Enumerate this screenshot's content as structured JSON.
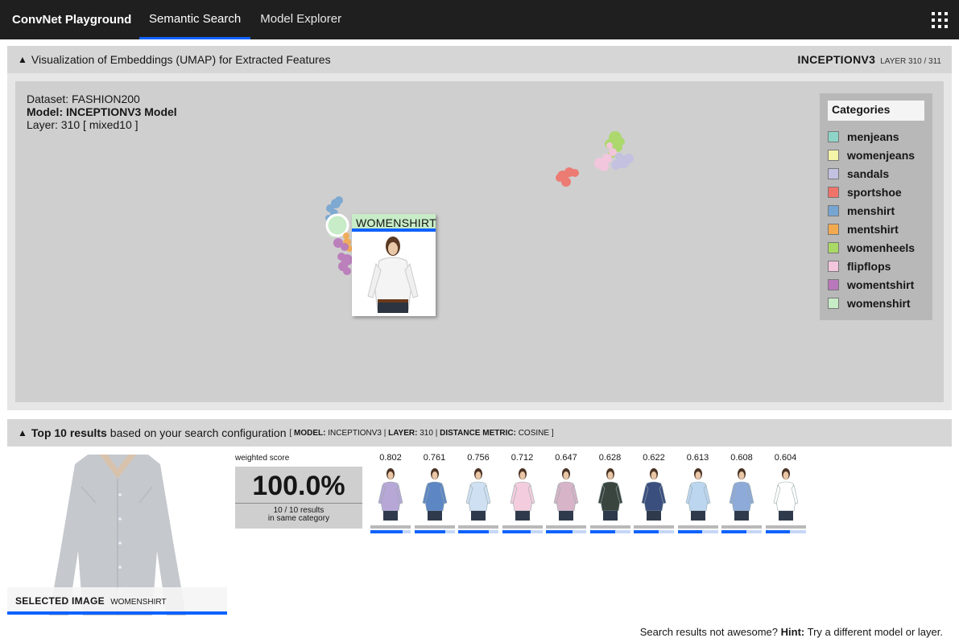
{
  "nav": {
    "brand": "ConvNet Playground",
    "tabs": [
      {
        "label": "Semantic Search",
        "active": true
      },
      {
        "label": "Model Explorer",
        "active": false
      }
    ],
    "menu_icon": "app-switcher-grid-icon"
  },
  "embedding_section": {
    "toggle_icon": "▲",
    "title": "Visualization of Embeddings (UMAP) for Extracted Features",
    "model": "INCEPTIONV3",
    "layer_text": "LAYER 310 / 311",
    "meta": {
      "dataset": "Dataset: FASHION200",
      "model": "Model: INCEPTIONV3 Model",
      "layer": "Layer: 310 [ mixed10 ]"
    },
    "categories_title": "Categories",
    "categories": [
      {
        "label": "menjeans",
        "color": "#8fd4c8"
      },
      {
        "label": "womenjeans",
        "color": "#f5f5a8"
      },
      {
        "label": "sandals",
        "color": "#c3c1e0"
      },
      {
        "label": "sportshoe",
        "color": "#f0736a"
      },
      {
        "label": "menshirt",
        "color": "#76a5d2"
      },
      {
        "label": "mentshirt",
        "color": "#f3a94f"
      },
      {
        "label": "womenheels",
        "color": "#a9d964"
      },
      {
        "label": "flipflops",
        "color": "#f4c6de"
      },
      {
        "label": "womentshirt",
        "color": "#b978bb"
      },
      {
        "label": "womenshirt",
        "color": "#c7ecc7"
      }
    ],
    "hover_label": "WOMENSHIRT"
  },
  "results_section": {
    "toggle_icon": "▲",
    "title_bold": "Top 10 results",
    "title_rest": "based on your search configuration",
    "config_open": "[",
    "config_model_key": "MODEL:",
    "config_model_val": "INCEPTIONV3",
    "config_layer_key": "LAYER:",
    "config_layer_val": "310",
    "config_metric_key": "DISTANCE METRIC:",
    "config_metric_val": "COSINE",
    "config_close": "]",
    "sep": "|",
    "selected_label": "SELECTED IMAGE",
    "selected_category": "WOMENSHIRT",
    "weighted_score_label": "weighted score",
    "weighted_score": "100.0%",
    "score_sub_1": "10 / 10 results",
    "score_sub_2": "in same category",
    "results": [
      {
        "score": "0.802",
        "shirt": "#b6a7d6",
        "fill": 0.8
      },
      {
        "score": "0.761",
        "shirt": "#5d86c4",
        "fill": 0.76
      },
      {
        "score": "0.756",
        "shirt": "#cfe0f3",
        "fill": 0.75
      },
      {
        "score": "0.712",
        "shirt": "#f3cddd",
        "fill": 0.71
      },
      {
        "score": "0.647",
        "shirt": "#d7b4c8",
        "fill": 0.65
      },
      {
        "score": "0.628",
        "shirt": "#3a4540",
        "fill": 0.63
      },
      {
        "score": "0.622",
        "shirt": "#3b4f7f",
        "fill": 0.62
      },
      {
        "score": "0.613",
        "shirt": "#bcd6f0",
        "fill": 0.61
      },
      {
        "score": "0.608",
        "shirt": "#8eaad8",
        "fill": 0.61
      },
      {
        "score": "0.604",
        "shirt": "#ffffff",
        "fill": 0.6
      }
    ]
  },
  "hint": {
    "lead": "Search results not awesome?",
    "bold": "Hint:",
    "text": "Try a different model or layer."
  },
  "accent_color": "#0f62fe"
}
